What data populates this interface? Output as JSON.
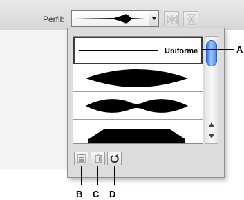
{
  "toolbar": {
    "profile_label": "Perfil:",
    "selected_profile_icon": "tapered-diamond-stroke"
  },
  "profile_list": {
    "items": [
      {
        "label": "Uniforme",
        "icon": "uniform-stroke",
        "selected": true
      },
      {
        "label": "",
        "icon": "lens-stroke",
        "selected": false
      },
      {
        "label": "",
        "icon": "double-lens-stroke",
        "selected": false
      },
      {
        "label": "",
        "icon": "hexagon-stroke",
        "selected": false
      }
    ]
  },
  "actions": {
    "save_icon": "save-icon",
    "delete_icon": "trash-icon",
    "reset_icon": "reset-icon"
  },
  "callouts": {
    "a": "A",
    "b": "B",
    "c": "C",
    "d": "D"
  }
}
